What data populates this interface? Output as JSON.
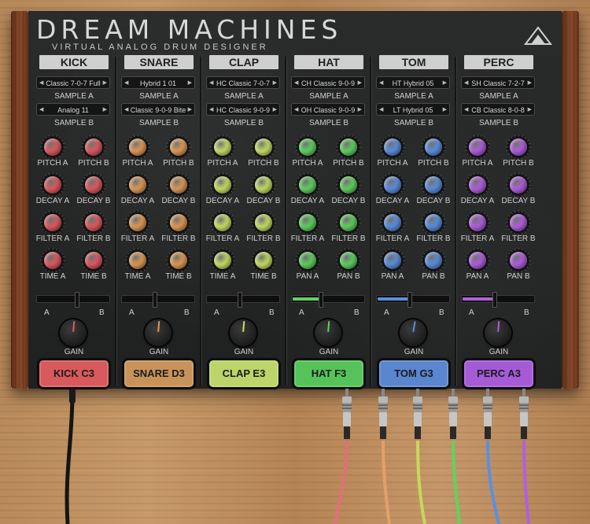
{
  "header": {
    "title": "DREAM MACHINES",
    "subtitle": "VIRTUAL ANALOG DRUM DESIGNER",
    "logo_icon": "mountain-triangle-icon"
  },
  "channels": [
    {
      "name": "KICK",
      "sample_a": "Classic 7-0-7 Full",
      "sample_a_label": "SAMPLE A",
      "sample_b": "Analog 11",
      "sample_b_label": "SAMPLE B",
      "knobs": [
        "PITCH A",
        "PITCH B",
        "DECAY A",
        "DECAY B",
        "FILTER A",
        "FILTER B",
        "TIME A",
        "TIME B"
      ],
      "color": "#e05a5f",
      "slider_a": "A",
      "slider_b": "B",
      "mix": 0.55,
      "gain_label": "GAIN",
      "pad": "KICK C3",
      "pad_color": "#d85a5c"
    },
    {
      "name": "SNARE",
      "sample_a": "Hybrid 1 01",
      "sample_a_label": "SAMPLE A",
      "sample_b": "Classic 9-0-9 Bite",
      "sample_b_label": "SAMPLE B",
      "knobs": [
        "PITCH A",
        "PITCH B",
        "DECAY A",
        "DECAY B",
        "FILTER A",
        "FILTER B",
        "TIME A",
        "TIME B"
      ],
      "color": "#e29a55",
      "slider_a": "A",
      "slider_b": "B",
      "mix": 0.46,
      "gain_label": "GAIN",
      "pad": "SNARE D3",
      "pad_color": "#c8935a"
    },
    {
      "name": "CLAP",
      "sample_a": "HC Classic 7-0-7",
      "sample_a_label": "SAMPLE A",
      "sample_b": "HC Classic 9-0-9",
      "sample_b_label": "SAMPLE B",
      "knobs": [
        "PITCH A",
        "PITCH B",
        "DECAY A",
        "DECAY B",
        "FILTER A",
        "FILTER B",
        "TIME A",
        "TIME B"
      ],
      "color": "#c6e064",
      "slider_a": "A",
      "slider_b": "B",
      "mix": 0.45,
      "gain_label": "GAIN",
      "pad": "CLAP E3",
      "pad_color": "#bcd46a"
    },
    {
      "name": "HAT",
      "sample_a": "CH Classic 9-0-9",
      "sample_a_label": "SAMPLE A",
      "sample_b": "OH Classic 9-0-9",
      "sample_b_label": "SAMPLE B",
      "knobs": [
        "PITCH A",
        "PITCH B",
        "DECAY A",
        "DECAY B",
        "FILTER A",
        "FILTER B",
        "PAN A",
        "PAN B"
      ],
      "color": "#5fd35f",
      "slider_a": "A",
      "slider_b": "B",
      "mix": 0.4,
      "gain_label": "GAIN",
      "pad": "HAT F3",
      "pad_color": "#56c35a"
    },
    {
      "name": "TOM",
      "sample_a": "HT Hybrid 05",
      "sample_a_label": "SAMPLE A",
      "sample_b": "LT Hybrid 05",
      "sample_b_label": "SAMPLE B",
      "knobs": [
        "PITCH A",
        "PITCH B",
        "DECAY A",
        "DECAY B",
        "FILTER A",
        "FILTER B",
        "PAN A",
        "PAN B"
      ],
      "color": "#5b8fe0",
      "slider_a": "A",
      "slider_b": "B",
      "mix": 0.45,
      "gain_label": "GAIN",
      "pad": "TOM G3",
      "pad_color": "#5a86d0"
    },
    {
      "name": "PERC",
      "sample_a": "SH Classic 7-2-7",
      "sample_a_label": "SAMPLE A",
      "sample_b": "CB Classic 8-0-8",
      "sample_b_label": "SAMPLE B",
      "knobs": [
        "PITCH A",
        "PITCH B",
        "DECAY A",
        "DECAY B",
        "FILTER A",
        "FILTER B",
        "PAN A",
        "PAN B"
      ],
      "color": "#b25ee0",
      "slider_a": "A",
      "slider_b": "B",
      "mix": 0.45,
      "gain_label": "GAIN",
      "pad": "PERC A3",
      "pad_color": "#a55ad6"
    }
  ]
}
